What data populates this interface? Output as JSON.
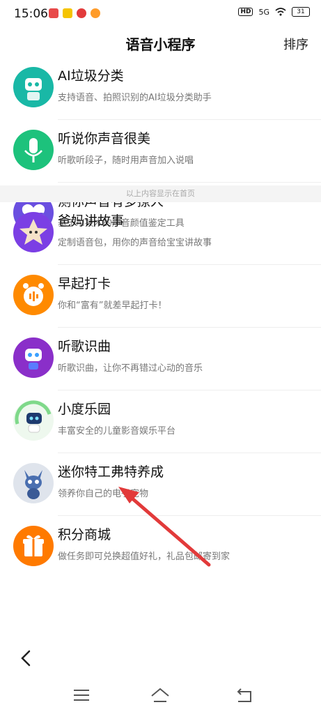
{
  "status": {
    "time": "15:06",
    "network": "5G",
    "hd": "HD",
    "battery": "31"
  },
  "header": {
    "title": "语音小程序",
    "sort_label": "排序"
  },
  "section_separator": "以上内容显示在首页",
  "items": [
    {
      "title": "AI垃圾分类",
      "desc": "支持语音、拍照识别的AI垃圾分类助手",
      "icon": "robot-trash-icon",
      "color": "#19b8a6"
    },
    {
      "title": "听说你声音很美",
      "desc": "听歌听段子，随时用声音加入说唱",
      "icon": "microphone-icon",
      "color": "#1dc27c"
    },
    {
      "title": "测你声音有多撩人",
      "desc": "基于AI技术的声音颜值鉴定工具",
      "icon": "heart-voice-icon",
      "color": "#6a4fe0"
    },
    {
      "title": "爸妈讲故事",
      "desc": "定制语音包，用你的声音给宝宝讲故事",
      "icon": "star-face-icon",
      "color": "#7b3fe4"
    },
    {
      "title": "早起打卡",
      "desc": "你和“富有”就差早起打卡！",
      "icon": "alarm-clock-icon",
      "color": "#ff8a00"
    },
    {
      "title": "听歌识曲",
      "desc": "听歌识曲，让你不再错过心动的音乐",
      "icon": "robot-music-icon",
      "color": "#8a2fc9"
    },
    {
      "title": "小度乐园",
      "desc": "丰富安全的儿童影音娱乐平台",
      "icon": "xiaodu-robot-icon",
      "color": "#7fd98a"
    },
    {
      "title": "迷你特工弗特养成",
      "desc": "领养你自己的电子宠物",
      "icon": "cat-agent-icon",
      "color": "#4a6fb0"
    },
    {
      "title": "积分商城",
      "desc": "做任务即可兑换超值好礼，礼品包邮寄到家",
      "icon": "gift-icon",
      "color": "#ff7a00"
    }
  ]
}
